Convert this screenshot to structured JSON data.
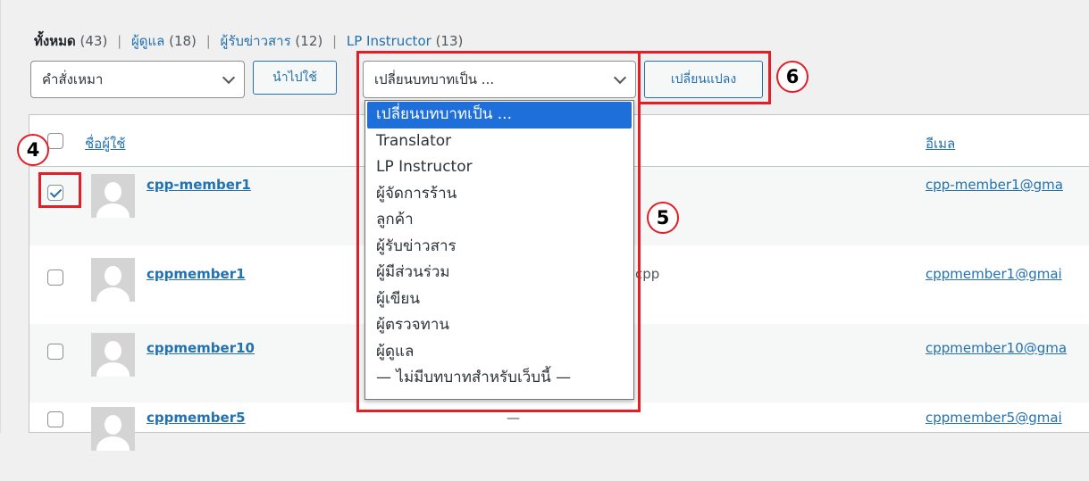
{
  "filters": {
    "all_label": "ทั้งหมด",
    "all_count": "(43)",
    "admin_label": "ผู้ดูแล",
    "admin_count": "(18)",
    "subscriber_label": "ผู้รับข่าวสาร",
    "subscriber_count": "(12)",
    "instructor_label": "LP Instructor",
    "instructor_count": "(13)",
    "separator": "|"
  },
  "bulk_actions": {
    "value": "คำสั่งเหมา",
    "apply_label": "นำไปใช้"
  },
  "role_change": {
    "value": "เปลี่ยนบทบาทเป็น ...",
    "change_label": "เปลี่ยนแปลง"
  },
  "role_options": [
    "เปลี่ยนบทบาทเป็น ...",
    "Translator",
    "LP Instructor",
    "ผู้จัดการร้าน",
    "ลูกค้า",
    "ผู้รับข่าวสาร",
    "ผู้มีส่วนร่วม",
    "ผู้เขียน",
    "ผู้ตรวจทาน",
    "ผู้ดูแล",
    "— ไม่มีบทบาทสำหรับเว็บนี้ —"
  ],
  "table": {
    "col_username": "ชื่อผู้ใช้",
    "col_email": "อีเมล",
    "rows": [
      {
        "username": "cpp-member1",
        "email": "cpp-member1@gma",
        "checked": true,
        "name": ""
      },
      {
        "username": "cppmember1",
        "email": "cppmember1@gmai",
        "checked": false,
        "name": "cpp"
      },
      {
        "username": "cppmember10",
        "email": "cppmember10@gma",
        "checked": false,
        "name": ""
      },
      {
        "username": "cppmember5",
        "email": "cppmember5@gmai",
        "checked": false,
        "name": "—"
      }
    ]
  },
  "annotations": {
    "step4": "4",
    "step5": "5",
    "step6": "6"
  },
  "colors": {
    "link": "#2271b1",
    "highlight": "#1e6fd9",
    "annotation": "#e41e26"
  }
}
